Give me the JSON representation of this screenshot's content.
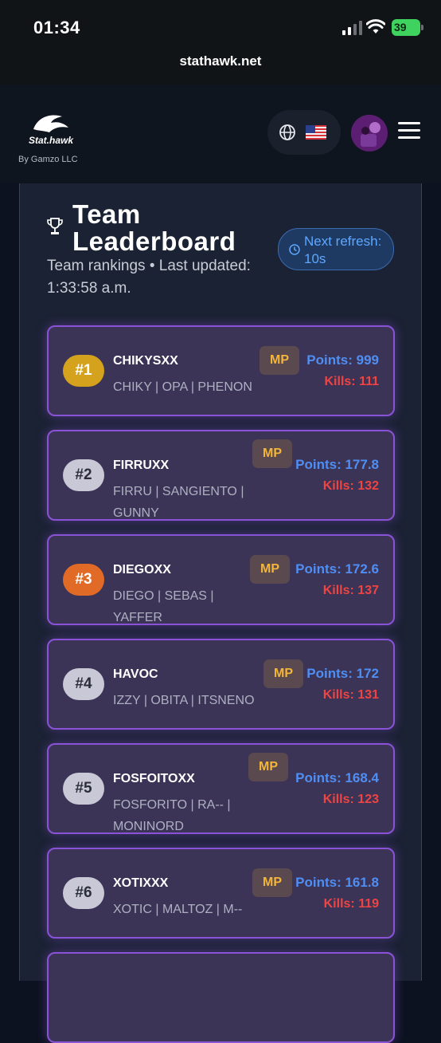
{
  "status_bar": {
    "time": "01:34",
    "battery": "39"
  },
  "browser": {
    "url": "stathawk.net"
  },
  "header": {
    "logo_text": "Stat.hawk",
    "byline": "By Gamzo LLC",
    "language_flag": "🇺🇸"
  },
  "leaderboard": {
    "title": "Team Leaderboard",
    "refresh": "Next refresh: 10s",
    "subtitle": "Team rankings • Last updated: 1:33:58 a.m.",
    "teams": [
      {
        "rank": "#1",
        "name": "CHIKYSXX",
        "members": "CHIKY | OPA | PHENON",
        "mode": "MP",
        "points": "Points: 999",
        "kills": "Kills: 111"
      },
      {
        "rank": "#2",
        "name": "FIRRUXX",
        "members": "FIRRU | SANGIENTO | GUNNY",
        "mode": "MP",
        "points": "Points: 177.8",
        "kills": "Kills: 132"
      },
      {
        "rank": "#3",
        "name": "DIEGOXX",
        "members": "DIEGO | SEBAS | YAFFER",
        "mode": "MP",
        "points": "Points: 172.6",
        "kills": "Kills: 137"
      },
      {
        "rank": "#4",
        "name": "HAVOC",
        "members": "IZZY | OBITA | ITSNENO",
        "mode": "MP",
        "points": "Points: 172",
        "kills": "Kills: 131"
      },
      {
        "rank": "#5",
        "name": "FOSFOITOXX",
        "members": "FOSFORITO | RA-- | MONINORD",
        "mode": "MP",
        "points": "Points: 168.4",
        "kills": "Kills: 123"
      },
      {
        "rank": "#6",
        "name": "XOTIXXX",
        "members": "XOTIC | MALTOZ | M--",
        "mode": "MP",
        "points": "Points: 161.8",
        "kills": "Kills: 119"
      }
    ]
  },
  "colors": {
    "gold": "#d4a21c",
    "silver": "#c8c8d6",
    "bronze": "#e06a26",
    "accent": "#8a52d6",
    "points": "#4f8ef3",
    "kills": "#ee4443"
  }
}
